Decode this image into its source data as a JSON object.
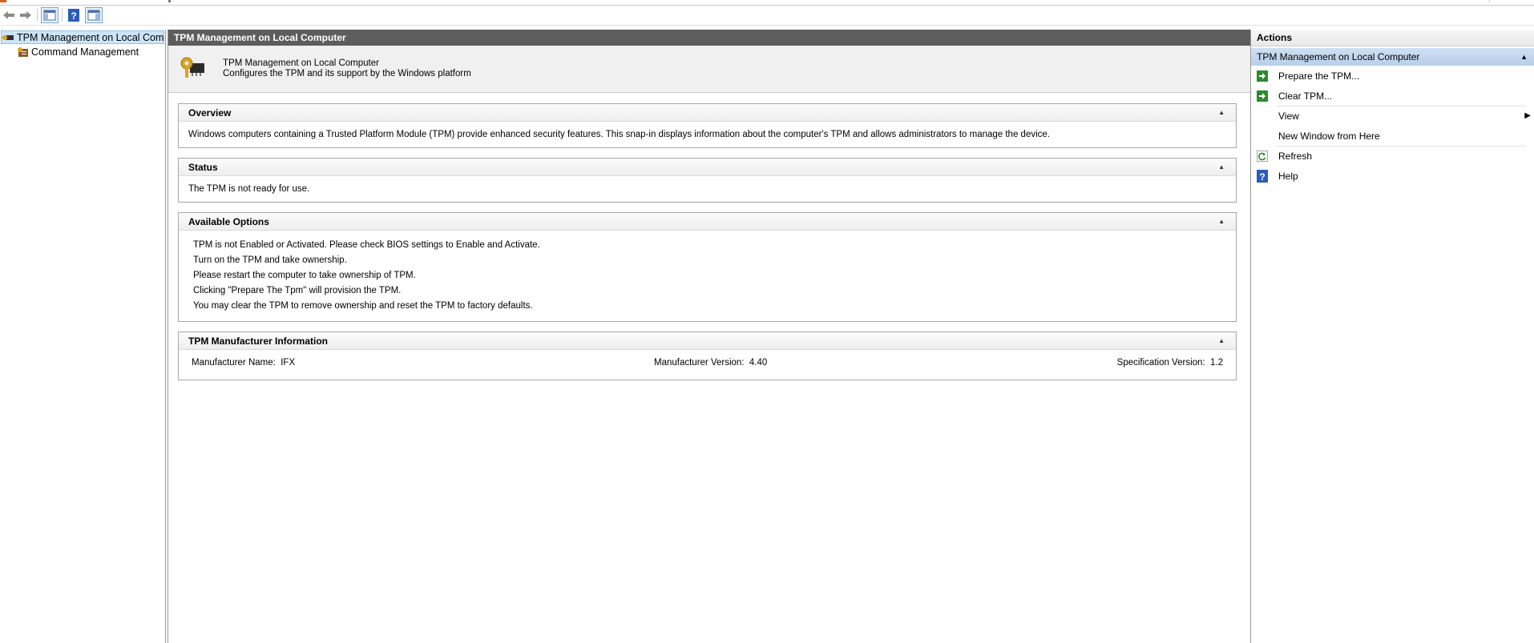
{
  "tree": {
    "items": [
      {
        "label": "TPM Management on Local Computer"
      },
      {
        "label": "Command Management"
      }
    ]
  },
  "center": {
    "title": "TPM Management on Local Computer",
    "header_title": "TPM Management on Local Computer",
    "header_subtitle": "Configures the TPM and its support by the Windows platform",
    "overview": {
      "heading": "Overview",
      "text": "Windows computers containing a Trusted Platform Module (TPM) provide enhanced security features. This snap-in displays information about the computer's TPM and allows administrators to manage the device."
    },
    "status": {
      "heading": "Status",
      "text": "The TPM is not ready for use."
    },
    "options": {
      "heading": "Available Options",
      "lines": [
        "TPM is not Enabled or Activated. Please check BIOS settings to Enable and Activate.",
        "Turn on the TPM and take ownership.",
        "Please restart the computer to take ownership of TPM.",
        "Clicking \"Prepare The Tpm\" will provision the TPM.",
        "You may clear the TPM to remove ownership and reset the TPM to factory defaults."
      ]
    },
    "manufacturer": {
      "heading": "TPM Manufacturer Information",
      "name_label": "Manufacturer Name:",
      "name_value": "IFX",
      "version_label": "Manufacturer Version:",
      "version_value": "4.40",
      "spec_label": "Specification Version:",
      "spec_value": "1.2"
    }
  },
  "actions": {
    "title": "Actions",
    "group": "TPM Management on Local Computer",
    "items": [
      {
        "label": "Prepare the TPM...",
        "icon": "green-arrow-icon"
      },
      {
        "label": "Clear TPM...",
        "icon": "green-arrow-icon"
      },
      {
        "label": "View",
        "icon": "none"
      },
      {
        "label": "New Window from Here",
        "icon": "none"
      },
      {
        "label": "Refresh",
        "icon": "refresh-icon"
      },
      {
        "label": "Help",
        "icon": "help-icon"
      }
    ]
  },
  "colors": {
    "title_bar": "#5d5d5d",
    "selection": "#cce4f7",
    "actions_group": "#b7cfea",
    "action_icon_green": "#2d8a2d"
  }
}
